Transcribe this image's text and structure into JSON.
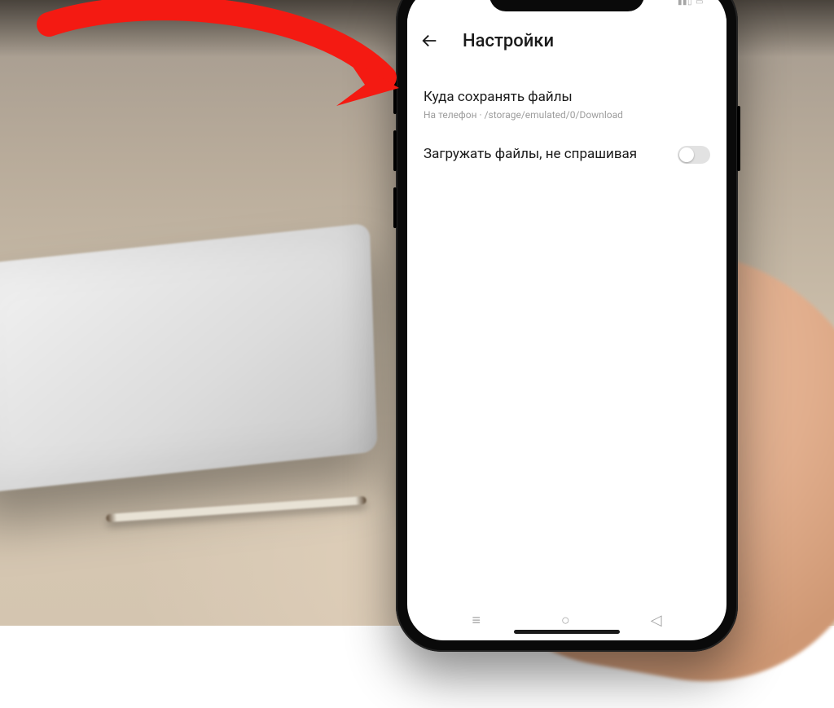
{
  "annotation": {
    "arrow_color": "#f41a12",
    "arrow_target": "save-location-row"
  },
  "statusbar": {
    "time": " ",
    "signal": "▮▮▯",
    "battery": "▭"
  },
  "header": {
    "title": "Настройки",
    "back_icon": "arrow-left"
  },
  "settings": {
    "save_location": {
      "title": "Куда сохранять файлы",
      "subtitle": "На телефон · /storage/emulated/0/Download"
    },
    "download_no_ask": {
      "title": "Загружать файлы, не спрашивая",
      "enabled": false
    }
  },
  "navbar": {
    "left": "≡",
    "center": "○",
    "right": "◁"
  }
}
